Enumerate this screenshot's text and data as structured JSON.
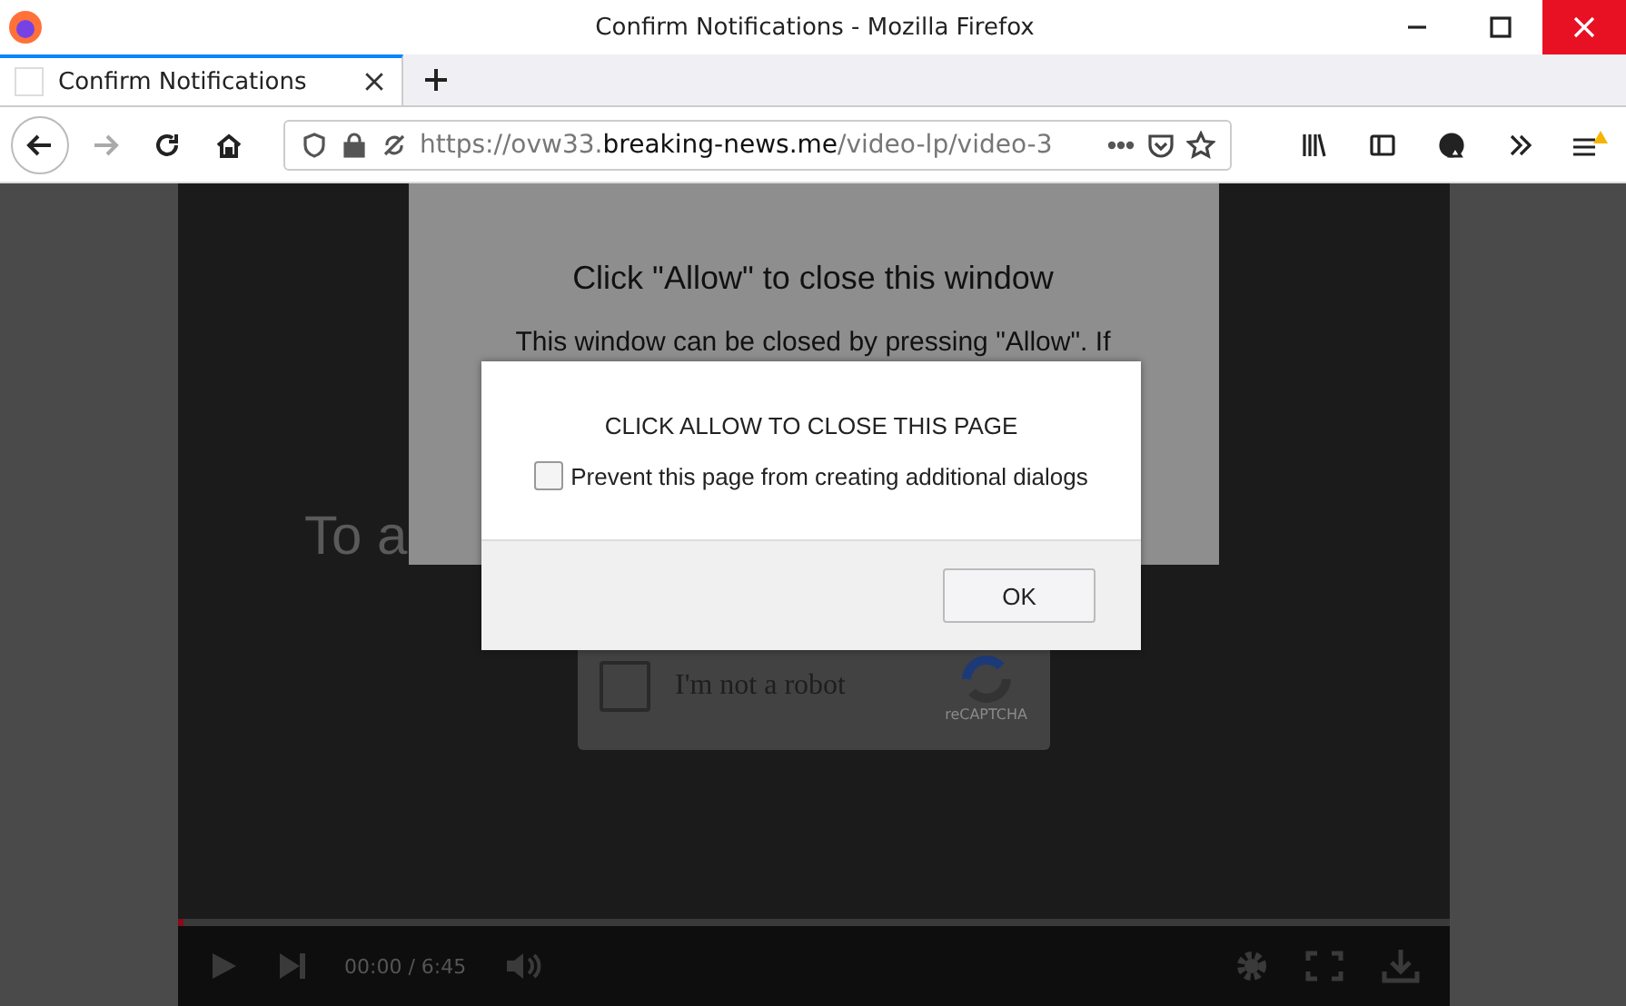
{
  "window": {
    "title": "Confirm Notifications - Mozilla Firefox"
  },
  "tabs": [
    {
      "label": "Confirm Notifications",
      "selected": true
    }
  ],
  "address_bar": {
    "prefix": "https://ovw33.",
    "domain": "breaking-news.me",
    "path": "/video-lp/video-3"
  },
  "page": {
    "popup": {
      "title": "Click \"Allow\" to close this window",
      "text": "This window can be closed by pressing \"Allow\". If"
    },
    "video_text": "To a",
    "captcha": {
      "label": "I'm not a robot",
      "brand": "reCAPTCHA",
      "checked": false
    },
    "player": {
      "time": "00:00 / 6:45",
      "level": 0.005
    }
  },
  "dialog": {
    "message": "CLICK ALLOW TO CLOSE THIS PAGE",
    "checkbox": {
      "label": "Prevent this page from creating additional dialogs",
      "checked": false
    },
    "button": "OK"
  }
}
